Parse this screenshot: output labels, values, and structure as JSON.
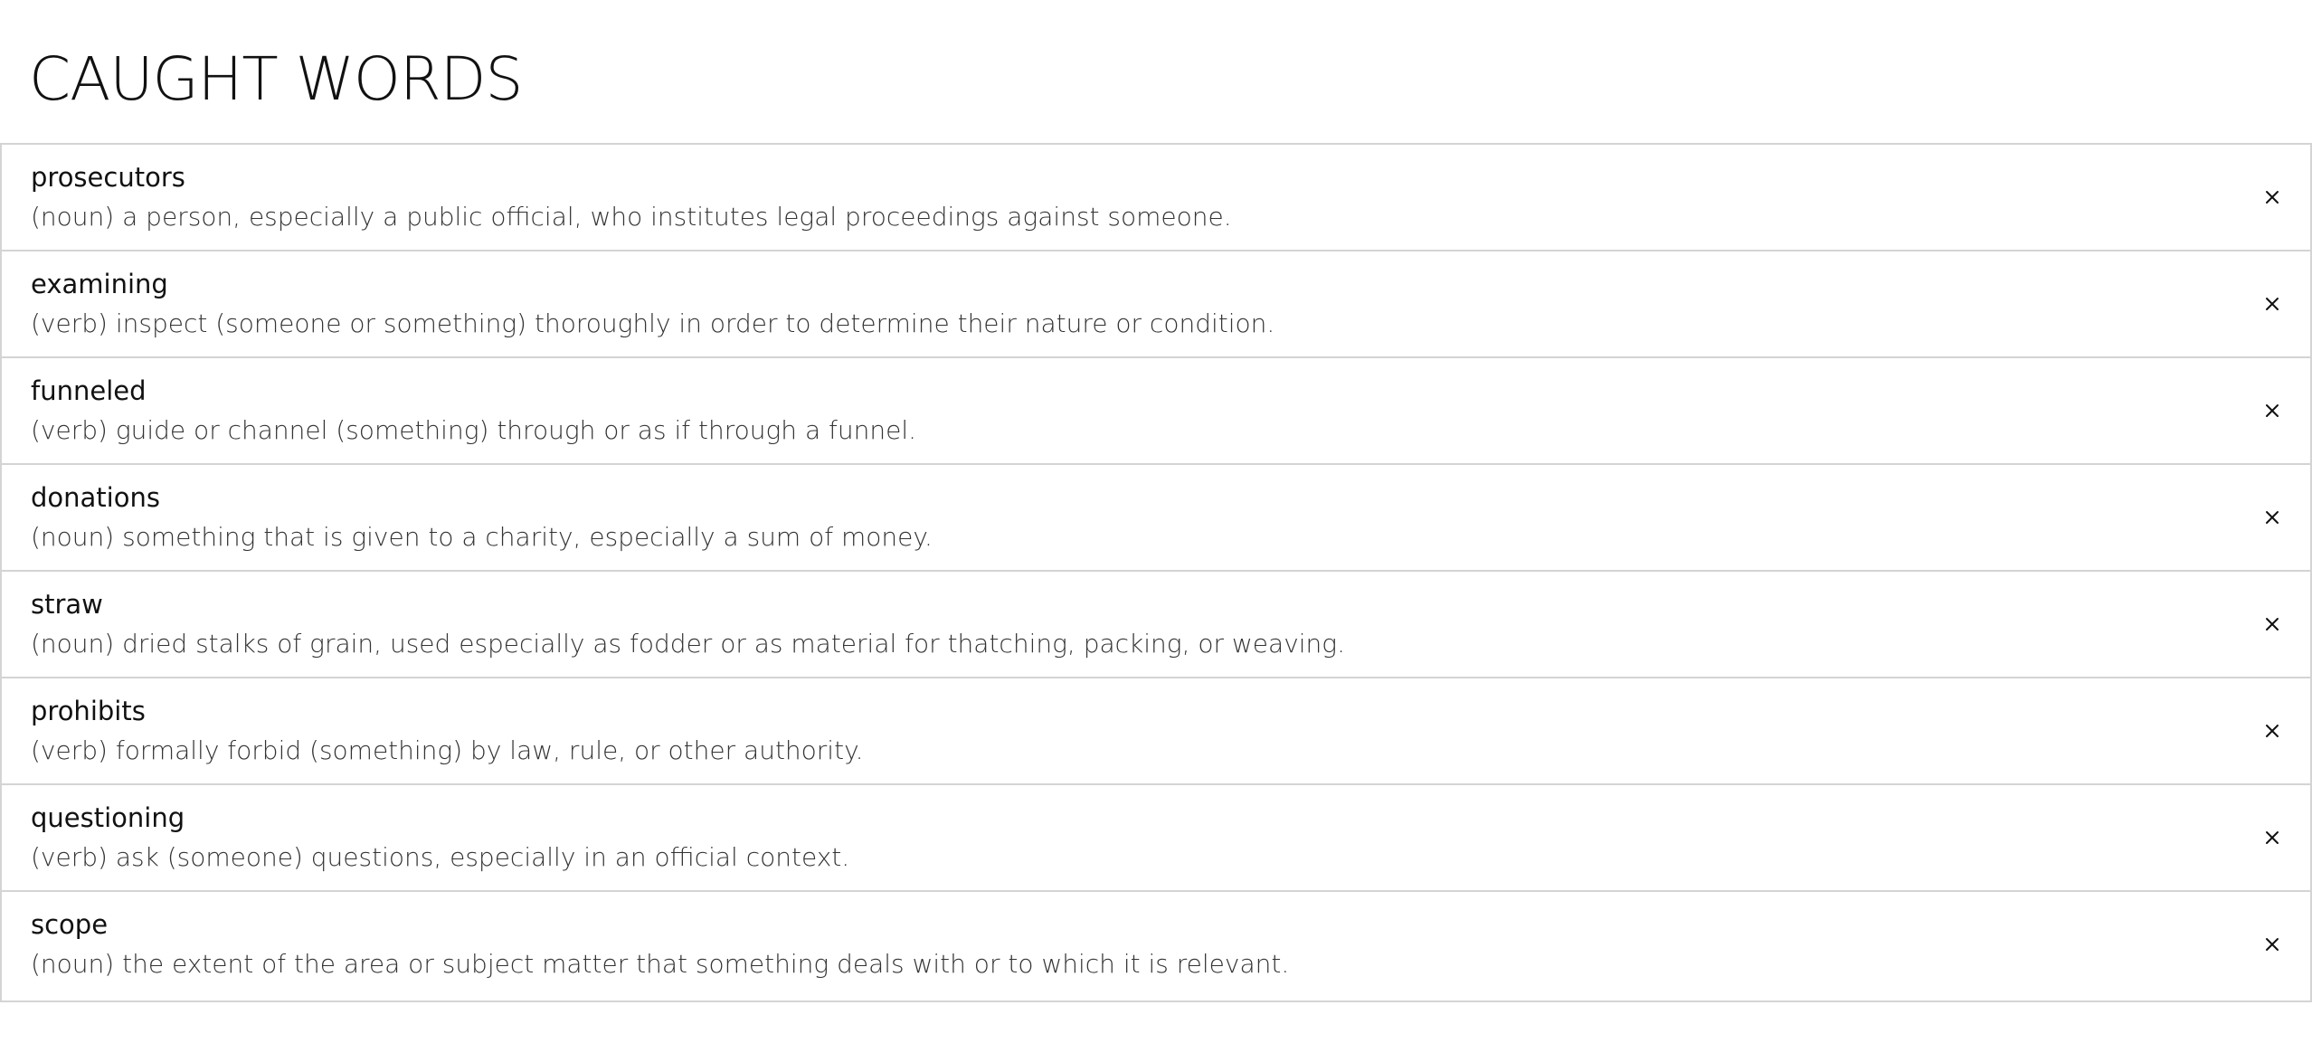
{
  "page": {
    "title": "CAUGHT WORDS"
  },
  "theme": {
    "text": "#111111",
    "definition_text": "#333333",
    "border": "#d4d4d4",
    "background": "#ffffff"
  },
  "words": [
    {
      "term": "prosecutors",
      "definition": "(noun) a person, especially a public official, who institutes legal proceedings against someone.",
      "remove_icon": "close-icon"
    },
    {
      "term": "examining",
      "definition": "(verb) inspect (someone or something) thoroughly in order to determine their nature or condition.",
      "remove_icon": "close-icon"
    },
    {
      "term": "funneled",
      "definition": "(verb) guide or channel (something) through or as if through a funnel.",
      "remove_icon": "close-icon"
    },
    {
      "term": "donations",
      "definition": "(noun) something that is given to a charity, especially a sum of money.",
      "remove_icon": "close-icon"
    },
    {
      "term": "straw",
      "definition": "(noun) dried stalks of grain, used especially as fodder or as material for thatching, packing, or weaving.",
      "remove_icon": "close-icon"
    },
    {
      "term": "prohibits",
      "definition": "(verb) formally forbid (something) by law, rule, or other authority.",
      "remove_icon": "close-icon"
    },
    {
      "term": "questioning",
      "definition": "(verb) ask (someone) questions, especially in an official context.",
      "remove_icon": "close-icon"
    },
    {
      "term": "scope",
      "definition": "(noun) the extent of the area or subject matter that something deals with or to which it is relevant.",
      "remove_icon": "close-icon"
    }
  ]
}
